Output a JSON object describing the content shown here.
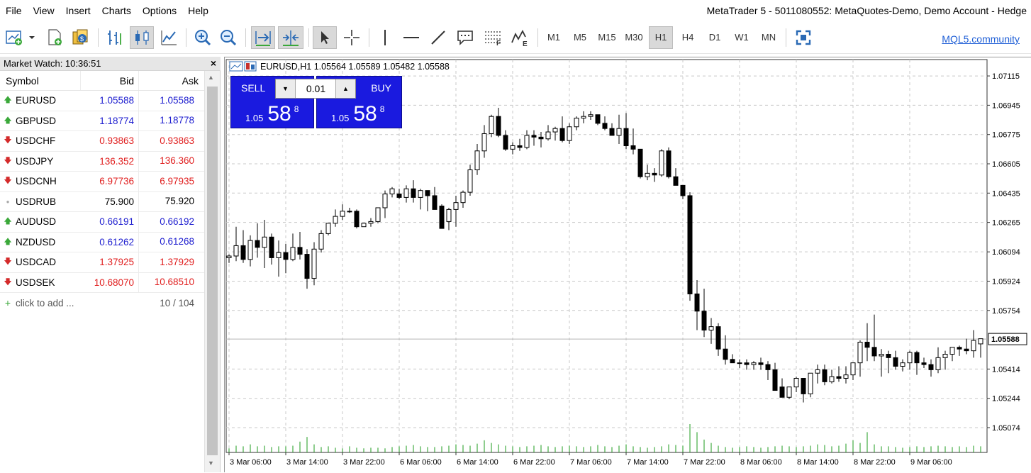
{
  "menu": [
    "File",
    "View",
    "Insert",
    "Charts",
    "Options",
    "Help"
  ],
  "window_title": "MetaTrader 5 - 5011080552: MetaQuotes-Demo, Demo Account - Hedge",
  "toolbar": {
    "timeframes": [
      "M1",
      "M5",
      "M15",
      "M30",
      "H1",
      "H4",
      "D1",
      "W1",
      "MN"
    ],
    "active_timeframe": "H1",
    "community_link": "MQL5.community"
  },
  "market_watch": {
    "title": "Market Watch: 10:36:51",
    "close": "×",
    "columns": [
      "Symbol",
      "Bid",
      "Ask"
    ],
    "rows": [
      {
        "symbol": "EURUSD",
        "bid": "1.05588",
        "ask": "1.05588",
        "dir": "up",
        "color": "#1d1dcf"
      },
      {
        "symbol": "GBPUSD",
        "bid": "1.18774",
        "ask": "1.18778",
        "dir": "up",
        "color": "#1d1dcf"
      },
      {
        "symbol": "USDCHF",
        "bid": "0.93863",
        "ask": "0.93863",
        "dir": "down",
        "color": "#e01e1e"
      },
      {
        "symbol": "USDJPY",
        "bid": "136.352",
        "ask": "136.360",
        "dir": "down",
        "color": "#e01e1e"
      },
      {
        "symbol": "USDCNH",
        "bid": "6.97736",
        "ask": "6.97935",
        "dir": "down",
        "color": "#e01e1e"
      },
      {
        "symbol": "USDRUB",
        "bid": "75.900",
        "ask": "75.920",
        "dir": "none",
        "color": "#000000"
      },
      {
        "symbol": "AUDUSD",
        "bid": "0.66191",
        "ask": "0.66192",
        "dir": "up",
        "color": "#1d1dcf"
      },
      {
        "symbol": "NZDUSD",
        "bid": "0.61262",
        "ask": "0.61268",
        "dir": "up",
        "color": "#1d1dcf"
      },
      {
        "symbol": "USDCAD",
        "bid": "1.37925",
        "ask": "1.37929",
        "dir": "down",
        "color": "#e01e1e"
      },
      {
        "symbol": "USDSEK",
        "bid": "10.68070",
        "ask": "10.68510",
        "dir": "down",
        "color": "#e01e1e"
      }
    ],
    "add_label": "click to add ...",
    "count": "10 / 104"
  },
  "chart": {
    "header": "EURUSD,H1  1.05564 1.05589 1.05482 1.05588",
    "sell_label": "SELL",
    "buy_label": "BUY",
    "lot": "0.01",
    "sell_price": {
      "small": "1.05",
      "big": "58",
      "sup": "8"
    },
    "buy_price": {
      "small": "1.05",
      "big": "58",
      "sup": "8"
    }
  },
  "chart_data": {
    "type": "candlestick",
    "symbol": "EURUSD",
    "timeframe": "H1",
    "current_price": "1.05588",
    "y_ticks": [
      "1.07115",
      "1.06945",
      "1.06775",
      "1.06605",
      "1.06435",
      "1.06265",
      "1.06094",
      "1.05924",
      "1.05754",
      "1.05414",
      "1.05244",
      "1.05074"
    ],
    "ylim": [
      1.0493,
      1.0721
    ],
    "x_ticks": [
      "3 Mar 06:00",
      "3 Mar 14:00",
      "3 Mar 22:00",
      "6 Mar 06:00",
      "6 Mar 14:00",
      "6 Mar 22:00",
      "7 Mar 06:00",
      "7 Mar 14:00",
      "7 Mar 22:00",
      "8 Mar 06:00",
      "8 Mar 14:00",
      "8 Mar 22:00",
      "9 Mar 06:00"
    ],
    "candles": [
      [
        1.0606,
        1.0608,
        1.0603,
        1.0607
      ],
      [
        1.0607,
        1.0624,
        1.0604,
        1.0613
      ],
      [
        1.0613,
        1.0622,
        1.0603,
        1.0605
      ],
      [
        1.0605,
        1.0619,
        1.0601,
        1.0616
      ],
      [
        1.0616,
        1.0626,
        1.0606,
        1.0612
      ],
      [
        1.0612,
        1.0628,
        1.06,
        1.0618
      ],
      [
        1.0618,
        1.062,
        1.0602,
        1.0606
      ],
      [
        1.0606,
        1.0616,
        1.0595,
        1.0609
      ],
      [
        1.0609,
        1.0614,
        1.0597,
        1.0605
      ],
      [
        1.0605,
        1.062,
        1.0604,
        1.0612
      ],
      [
        1.0612,
        1.0621,
        1.0605,
        1.0608
      ],
      [
        1.0608,
        1.0611,
        1.0588,
        1.0594
      ],
      [
        1.0594,
        1.0615,
        1.059,
        1.0611
      ],
      [
        1.0611,
        1.0622,
        1.0609,
        1.062
      ],
      [
        1.062,
        1.0626,
        1.0619,
        1.0626
      ],
      [
        1.0626,
        1.0634,
        1.0624,
        1.063
      ],
      [
        1.063,
        1.0637,
        1.0628,
        1.0633
      ],
      [
        1.0633,
        1.0635,
        1.0632,
        1.0633
      ],
      [
        1.0633,
        1.0634,
        1.0623,
        1.0624
      ],
      [
        1.0624,
        1.0626,
        1.0624,
        1.0626
      ],
      [
        1.0626,
        1.0629,
        1.0624,
        1.0627
      ],
      [
        1.0627,
        1.0634,
        1.0626,
        1.0635
      ],
      [
        1.0635,
        1.0645,
        1.0629,
        1.0643
      ],
      [
        1.0643,
        1.0647,
        1.0641,
        1.0646
      ],
      [
        1.0643,
        1.0646,
        1.064,
        1.0641
      ],
      [
        1.0641,
        1.0648,
        1.0638,
        1.0646
      ],
      [
        1.0646,
        1.0651,
        1.0638,
        1.0641
      ],
      [
        1.0641,
        1.0646,
        1.0634,
        1.0645
      ],
      [
        1.0645,
        1.0644,
        1.0633,
        1.0642
      ],
      [
        1.0642,
        1.0647,
        1.0636,
        1.0634
      ],
      [
        1.0636,
        1.0637,
        1.0627,
        1.0623
      ],
      [
        1.0627,
        1.0635,
        1.0622,
        1.0634
      ],
      [
        1.0634,
        1.0642,
        1.0624,
        1.0638
      ],
      [
        1.0638,
        1.0645,
        1.0635,
        1.0644
      ],
      [
        1.0644,
        1.066,
        1.0642,
        1.0657
      ],
      [
        1.0657,
        1.0672,
        1.0654,
        1.0668
      ],
      [
        1.0668,
        1.0683,
        1.0664,
        1.0678
      ],
      [
        1.0678,
        1.0689,
        1.0676,
        1.0688
      ],
      [
        1.0688,
        1.0693,
        1.0676,
        1.0677
      ],
      [
        1.0677,
        1.068,
        1.0668,
        1.0669
      ],
      [
        1.0669,
        1.0673,
        1.0666,
        1.0671
      ],
      [
        1.0671,
        1.0675,
        1.0668,
        1.067
      ],
      [
        1.067,
        1.068,
        1.0669,
        1.0677
      ],
      [
        1.0677,
        1.068,
        1.0671,
        1.0676
      ],
      [
        1.0676,
        1.0679,
        1.067,
        1.0675
      ],
      [
        1.0675,
        1.0683,
        1.0674,
        1.0679
      ],
      [
        1.0679,
        1.0682,
        1.0674,
        1.0681
      ],
      [
        1.0681,
        1.0688,
        1.0673,
        1.0674
      ],
      [
        1.0674,
        1.0684,
        1.0672,
        1.0682
      ],
      [
        1.0682,
        1.0688,
        1.068,
        1.0687
      ],
      [
        1.0687,
        1.0691,
        1.0684,
        1.0688
      ],
      [
        1.0688,
        1.0691,
        1.0686,
        1.0689
      ],
      [
        1.0689,
        1.0689,
        1.0683,
        1.0684
      ],
      [
        1.0684,
        1.0688,
        1.068,
        1.0681
      ],
      [
        1.0681,
        1.0684,
        1.0677,
        1.0677
      ],
      [
        1.0677,
        1.0689,
        1.0672,
        1.0681
      ],
      [
        1.0681,
        1.069,
        1.0669,
        1.0671
      ],
      [
        1.0671,
        1.0681,
        1.0666,
        1.0669
      ],
      [
        1.0669,
        1.0669,
        1.0652,
        1.0653
      ],
      [
        1.0653,
        1.066,
        1.0651,
        1.0655
      ],
      [
        1.0655,
        1.0658,
        1.065,
        1.0654
      ],
      [
        1.0654,
        1.0669,
        1.0653,
        1.0668
      ],
      [
        1.0668,
        1.067,
        1.0652,
        1.0653
      ],
      [
        1.0653,
        1.0658,
        1.0649,
        1.0648
      ],
      [
        1.0648,
        1.0648,
        1.064,
        1.0642
      ],
      [
        1.0642,
        1.0644,
        1.0581,
        1.0585
      ],
      [
        1.0585,
        1.0593,
        1.0564,
        1.0575
      ],
      [
        1.0575,
        1.0588,
        1.056,
        1.0564
      ],
      [
        1.0564,
        1.0571,
        1.0556,
        1.0566
      ],
      [
        1.0566,
        1.0568,
        1.0549,
        1.0553
      ],
      [
        1.0553,
        1.0561,
        1.0544,
        1.0547
      ],
      [
        1.0547,
        1.055,
        1.0545,
        1.0545
      ],
      [
        1.0545,
        1.0547,
        1.0542,
        1.0545
      ],
      [
        1.0545,
        1.0547,
        1.0541,
        1.0544
      ],
      [
        1.0544,
        1.0546,
        1.0541,
        1.0545
      ],
      [
        1.0545,
        1.0548,
        1.0541,
        1.0544
      ],
      [
        1.0544,
        1.0546,
        1.0535,
        1.0541
      ],
      [
        1.0541,
        1.0545,
        1.0531,
        1.0529
      ],
      [
        1.0531,
        1.0536,
        1.0525,
        1.0525
      ],
      [
        1.0525,
        1.0531,
        1.0524,
        1.0531
      ],
      [
        1.0531,
        1.0537,
        1.0528,
        1.0536
      ],
      [
        1.0536,
        1.0536,
        1.0522,
        1.0527
      ],
      [
        1.0527,
        1.0538,
        1.0525,
        1.0539
      ],
      [
        1.0539,
        1.0544,
        1.0533,
        1.0541
      ],
      [
        1.0541,
        1.0544,
        1.0532,
        1.0534
      ],
      [
        1.0534,
        1.0541,
        1.0533,
        1.0537
      ],
      [
        1.0537,
        1.0543,
        1.0534,
        1.0536
      ],
      [
        1.0536,
        1.0543,
        1.0533,
        1.0538
      ],
      [
        1.0538,
        1.0545,
        1.0535,
        1.0545
      ],
      [
        1.0545,
        1.0558,
        1.0537,
        1.0557
      ],
      [
        1.0557,
        1.0568,
        1.0546,
        1.0554
      ],
      [
        1.0554,
        1.0573,
        1.0546,
        1.0549
      ],
      [
        1.0549,
        1.0553,
        1.0537,
        1.055
      ],
      [
        1.055,
        1.0552,
        1.0539,
        1.0548
      ],
      [
        1.0548,
        1.0552,
        1.0541,
        1.0543
      ],
      [
        1.0543,
        1.0547,
        1.054,
        1.0545
      ],
      [
        1.0545,
        1.0552,
        1.0541,
        1.0551
      ],
      [
        1.0551,
        1.0552,
        1.0538,
        1.0545
      ],
      [
        1.0545,
        1.0548,
        1.0542,
        1.0544
      ],
      [
        1.0544,
        1.0547,
        1.0537,
        1.0541
      ],
      [
        1.0541,
        1.0554,
        1.0539,
        1.0548
      ],
      [
        1.0548,
        1.0552,
        1.0541,
        1.055
      ],
      [
        1.055,
        1.0554,
        1.0546,
        1.0554
      ],
      [
        1.0554,
        1.0555,
        1.0549,
        1.0553
      ],
      [
        1.0553,
        1.0559,
        1.055,
        1.0552
      ],
      [
        1.0552,
        1.0564,
        1.0548,
        1.0558
      ],
      [
        1.0556,
        1.0559,
        1.0548,
        1.0559
      ]
    ],
    "volumes": [
      6,
      10,
      9,
      12,
      9,
      10,
      8,
      9,
      9,
      10,
      16,
      23,
      12,
      8,
      9,
      7,
      6,
      9,
      7,
      6,
      7,
      7,
      6,
      8,
      9,
      10,
      11,
      9,
      8,
      8,
      9,
      10,
      12,
      11,
      10,
      13,
      18,
      14,
      12,
      10,
      9,
      8,
      9,
      10,
      11,
      9,
      8,
      9,
      10,
      9,
      8,
      9,
      11,
      9,
      8,
      10,
      12,
      9,
      8,
      7,
      8,
      9,
      12,
      11,
      10,
      42,
      30,
      19,
      14,
      10,
      8,
      7,
      8,
      9,
      8,
      7,
      8,
      9,
      10,
      9,
      8,
      9,
      10,
      12,
      11,
      9,
      10,
      13,
      18,
      14,
      30,
      12,
      9,
      9,
      8,
      7,
      8,
      9,
      8,
      9,
      10,
      9,
      8,
      9,
      8,
      10,
      9,
      8,
      7
    ],
    "grid": true
  }
}
